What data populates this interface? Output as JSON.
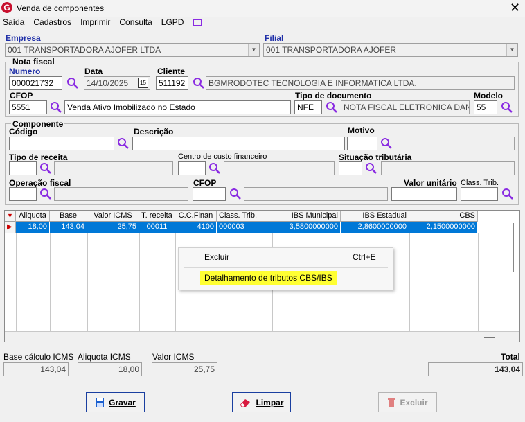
{
  "window": {
    "title": "Venda de componentes"
  },
  "menu": {
    "items": [
      "Saída",
      "Cadastros",
      "Imprimir",
      "Consulta",
      "LGPD"
    ]
  },
  "empresa": {
    "label": "Empresa",
    "value": "001 TRANSPORTADORA AJOFER LTDA"
  },
  "filial": {
    "label": "Filial",
    "value": "001 TRANSPORTADORA AJOFER"
  },
  "nota_fiscal": {
    "group_title": "Nota fiscal",
    "numero_label": "Numero",
    "numero_value": "000021732",
    "data_label": "Data",
    "data_value": "14/10/2025",
    "calendar_icon_text": "15",
    "cliente_label": "Cliente",
    "cliente_code": "511192",
    "cliente_name": "BGMRODOTEC TECNOLOGIA E INFORMATICA LTDA.",
    "cfop_label": "CFOP",
    "cfop_value": "5551",
    "cfop_desc": "Venda Ativo Imobilizado no Estado",
    "tipo_doc_label": "Tipo de documento",
    "tipo_doc_code": "NFE",
    "tipo_doc_desc": "NOTA FISCAL ELETRONICA DANFE",
    "modelo_label": "Modelo",
    "modelo_value": "55"
  },
  "componente": {
    "group_title": "Componente",
    "codigo_label": "Código",
    "codigo_value": "",
    "descricao_label": "Descrição",
    "descricao_value": "",
    "motivo_label": "Motivo",
    "motivo_value": "",
    "tipo_receita_label": "Tipo de receita",
    "centro_custo_label": "Centro de custo financeiro",
    "situacao_label": "Situação tributária",
    "operacao_label": "Operação fiscal",
    "cfop_label": "CFOP",
    "valor_unitario_label": "Valor unitário",
    "class_trib_label": "Class. Trib."
  },
  "grid": {
    "columns": [
      "Aliquota",
      "Base",
      "Valor ICMS",
      "T. receita",
      "C.C.Finan",
      "Class. Trib.",
      "IBS Municipal",
      "IBS Estadual",
      "CBS"
    ],
    "rows": [
      [
        "18,00",
        "143,04",
        "25,75",
        "00011",
        "4100",
        "000003",
        "3,5800000000",
        "2,8600000000",
        "2,1500000000"
      ]
    ]
  },
  "context_menu": {
    "items": [
      {
        "label": "Excluir",
        "shortcut": "Ctrl+E"
      },
      {
        "label": "Detalhamento de tributos CBS/IBS",
        "shortcut": ""
      }
    ],
    "highlight_color": "#ffff33"
  },
  "totals": {
    "base_calculo_label": "Base cálculo ICMS",
    "base_calculo_value": "143,04",
    "aliquota_label": "Aliquota ICMS",
    "aliquota_value": "18,00",
    "valor_icms_label": "Valor ICMS",
    "valor_icms_value": "25,75",
    "total_label": "Total",
    "total_value": "143,04"
  },
  "buttons": {
    "gravar": "Gravar",
    "limpar": "Limpar",
    "excluir": "Excluir"
  },
  "colors": {
    "accent_blue": "#1f2fa8",
    "selection": "#0078d7",
    "search_icon": "#8a2be2",
    "brand": "#c8102e"
  }
}
